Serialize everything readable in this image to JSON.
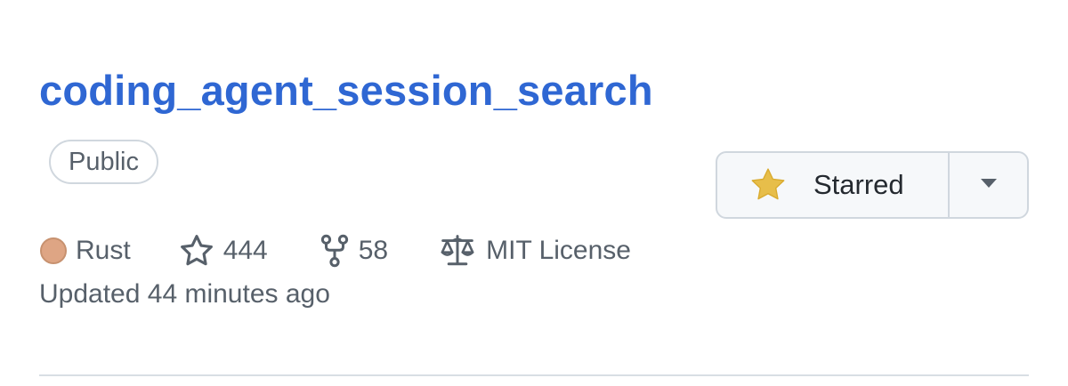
{
  "repo": {
    "name": "coding_agent_session_search",
    "visibility": "Public",
    "star_button": {
      "label": "Starred",
      "icon": "star-filled-icon",
      "dropdown_icon": "triangle-down-icon"
    },
    "language": {
      "name": "Rust",
      "color": "#dea584"
    },
    "stars": "444",
    "forks": "58",
    "license": "MIT License",
    "updated": "Updated 44 minutes ago"
  },
  "colors": {
    "link": "#2f67d3",
    "muted_text": "#57606a",
    "star_yellow": "#e3b341",
    "border": "#d0d7de"
  }
}
